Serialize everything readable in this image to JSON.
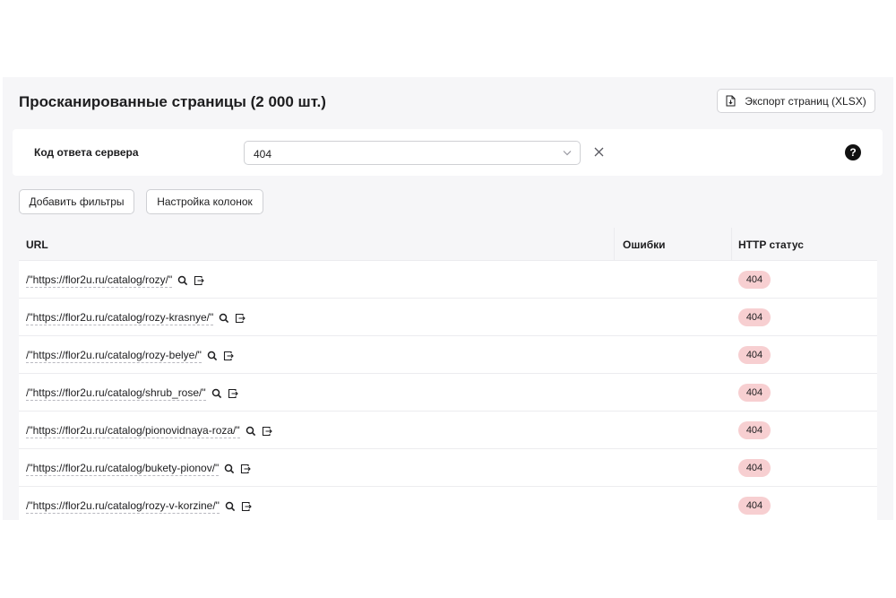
{
  "header": {
    "title": "Просканированные страницы (2 000 шт.)",
    "export_label": "Экспорт страниц (XLSX)"
  },
  "filter": {
    "label": "Код ответа сервера",
    "value": "404"
  },
  "actions": {
    "add_filters_label": "Добавить фильтры",
    "columns_label": "Настройка колонок"
  },
  "table": {
    "columns": [
      "URL",
      "Ошибки",
      "HTTP статус"
    ],
    "rows": [
      {
        "url": "/\"https://flor2u.ru/catalog/rozy/\"",
        "errors": "",
        "status": "404"
      },
      {
        "url": "/\"https://flor2u.ru/catalog/rozy-krasnye/\"",
        "errors": "",
        "status": "404"
      },
      {
        "url": "/\"https://flor2u.ru/catalog/rozy-belye/\"",
        "errors": "",
        "status": "404"
      },
      {
        "url": "/\"https://flor2u.ru/catalog/shrub_rose/\"",
        "errors": "",
        "status": "404"
      },
      {
        "url": "/\"https://flor2u.ru/catalog/pionovidnaya-roza/\"",
        "errors": "",
        "status": "404"
      },
      {
        "url": "/\"https://flor2u.ru/catalog/bukety-pionov/\"",
        "errors": "",
        "status": "404"
      },
      {
        "url": "/\"https://flor2u.ru/catalog/rozy-v-korzine/\"",
        "errors": "",
        "status": "404"
      }
    ]
  },
  "colors": {
    "panel_bg": "#f6f6f8",
    "badge_bg": "#f7cfd1",
    "text": "#1d1d1f"
  }
}
